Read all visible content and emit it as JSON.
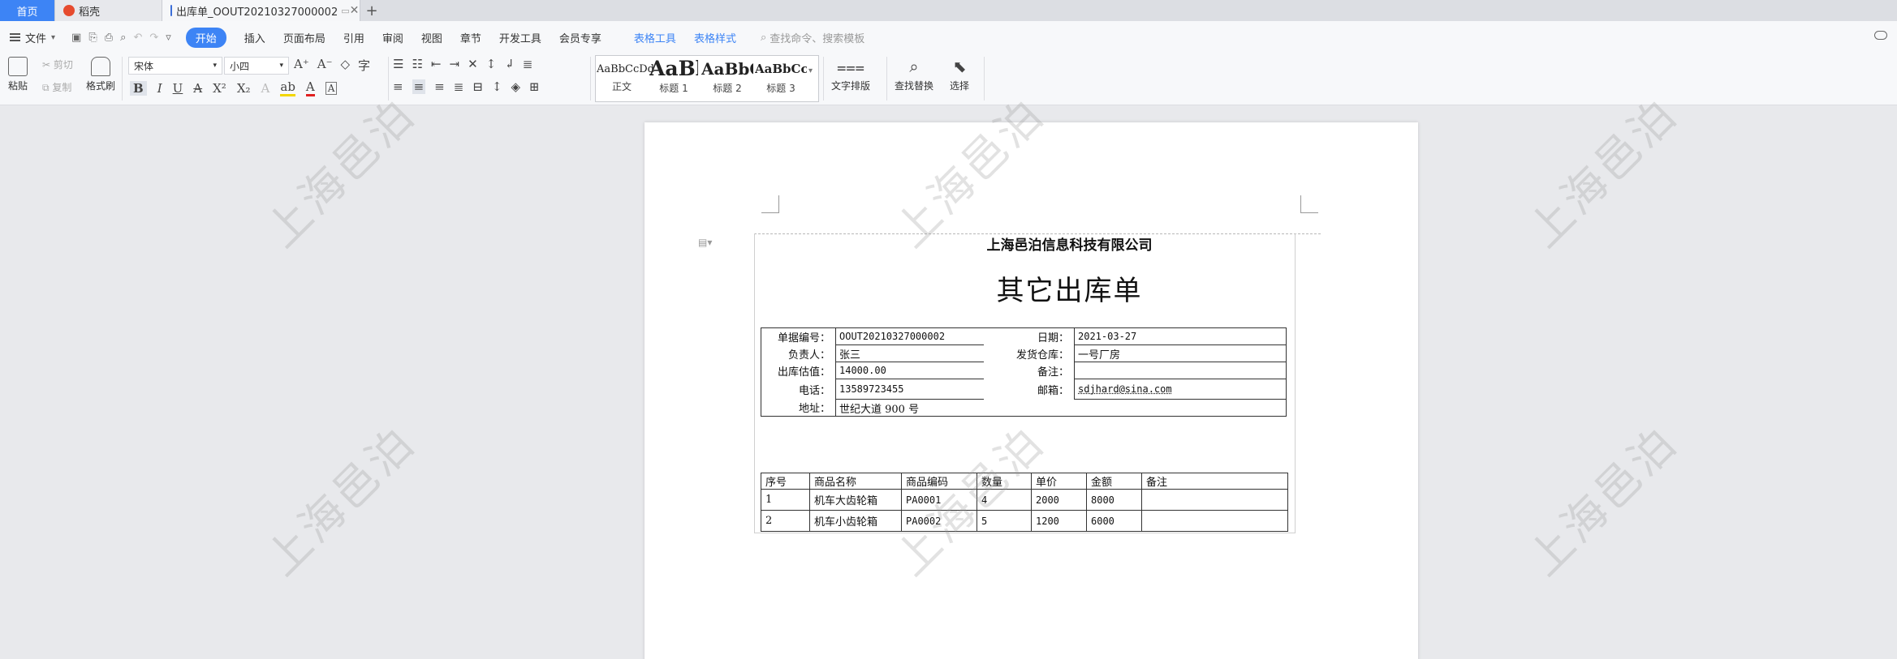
{
  "tabs": [
    {
      "label": "首页"
    },
    {
      "label": "稻壳"
    },
    {
      "label": "出库单_OOUT20210327000002"
    }
  ],
  "menu": {
    "file": "文件",
    "items": [
      "开始",
      "插入",
      "页面布局",
      "引用",
      "审阅",
      "视图",
      "章节",
      "开发工具",
      "会员专享",
      "表格工具",
      "表格样式"
    ],
    "search_placeholder": "查找命令、搜索模板"
  },
  "ribbon": {
    "paste": "粘贴",
    "cut": "剪切",
    "copy": "复制",
    "format_painter": "格式刷",
    "font_name": "宋体",
    "font_size": "小四",
    "styles": [
      {
        "sample": "AaBbCcDd",
        "label": "正文"
      },
      {
        "sample": "AaBb",
        "label": "标题 1"
      },
      {
        "sample": "AaBbC",
        "label": "标题 2"
      },
      {
        "sample": "AaBbCcI",
        "label": "标题 3"
      }
    ],
    "text_layout": "文字排版",
    "find_replace": "查找替换",
    "select": "选择"
  },
  "document": {
    "company": "上海邑泊信息科技有限公司",
    "title": "其它出库单",
    "fields": {
      "doc_no_label": "单据编号：",
      "doc_no": "OOUT20210327000002",
      "date_label": "日期：",
      "date": "2021-03-27",
      "owner_label": "负责人：",
      "owner": "张三",
      "warehouse_label": "发货仓库：",
      "warehouse": "一号厂房",
      "value_label": "出库估值：",
      "value": "14000.00",
      "remark_label": "备注：",
      "remark": "",
      "phone_label": "电话：",
      "phone": "13589723455",
      "email_label": "邮箱：",
      "email": "sdjhard@sina.com",
      "address_label": "地址：",
      "address": "世纪大道 900 号"
    },
    "items_header": [
      "序号",
      "商品名称",
      "商品编码",
      "数量",
      "单价",
      "金额",
      "备注"
    ],
    "items": [
      [
        "1",
        "机车大齿轮箱",
        "PA0001",
        "4",
        "2000",
        "8000",
        ""
      ],
      [
        "2",
        "机车小齿轮箱",
        "PA0002",
        "5",
        "1200",
        "6000",
        ""
      ]
    ]
  },
  "watermark": "上海邑泊"
}
